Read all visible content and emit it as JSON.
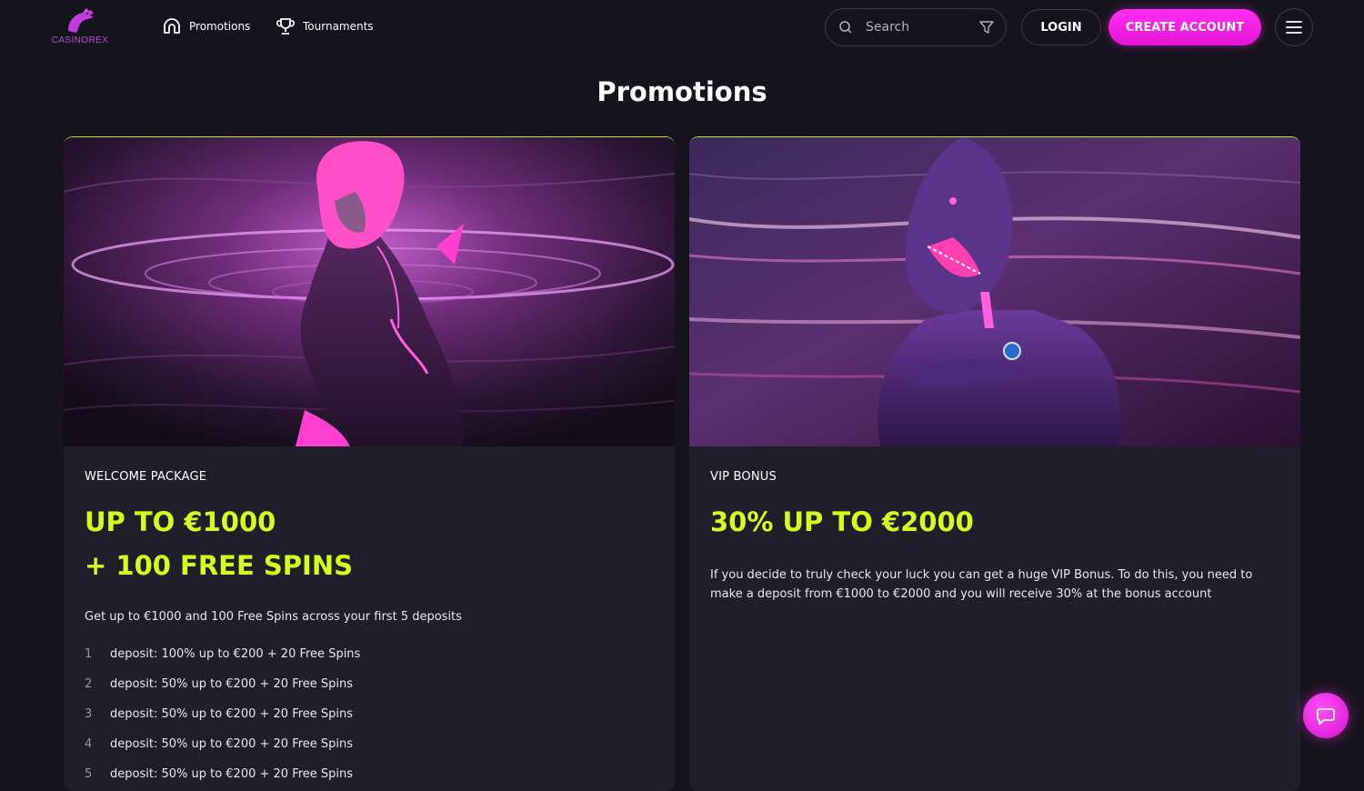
{
  "header": {
    "logo_text": "CASINOREX",
    "nav": [
      {
        "label": "Promotions",
        "icon": "arch-icon"
      },
      {
        "label": "Tournaments",
        "icon": "trophy-icon"
      }
    ],
    "search": {
      "placeholder": "Search",
      "value": ""
    },
    "login_label": "LOGIN",
    "create_account_label": "CREATE ACCOUNT",
    "menu_icon": "hamburger-icon"
  },
  "page": {
    "title": "Promotions"
  },
  "promotions": [
    {
      "label": "WELCOME PACKAGE",
      "headline_lines": [
        "UP TO €1000",
        "+ 100 FREE SPINS"
      ],
      "description": "Get up to €1000 and 100 Free Spins across your first 5 deposits",
      "deposits": [
        {
          "num": "1",
          "text": "deposit: 100% up to €200 + 20 Free Spins"
        },
        {
          "num": "2",
          "text": "deposit: 50% up to €200 + 20 Free Spins"
        },
        {
          "num": "3",
          "text": "deposit: 50% up to €200 + 20 Free Spins"
        },
        {
          "num": "4",
          "text": "deposit: 50% up to €200 + 20 Free Spins"
        },
        {
          "num": "5",
          "text": "deposit: 50% up to €200 + 20 Free Spins"
        }
      ]
    },
    {
      "label": "VIP BONUS",
      "headline_lines": [
        "30% UP TO €2000"
      ],
      "description": "If you decide to truly check your luck you can get a huge VIP Bonus. To do this, you need to make a deposit from €1000 to €2000 and you will receive 30% at the bonus account"
    }
  ],
  "colors": {
    "background": "#15141c",
    "card": "#201f29",
    "accent_pink": "#ff2ef0",
    "accent_lime": "#d4ff1c",
    "brand_purple": "#b34bd9"
  },
  "chat_icon": "chat-bubble-icon"
}
